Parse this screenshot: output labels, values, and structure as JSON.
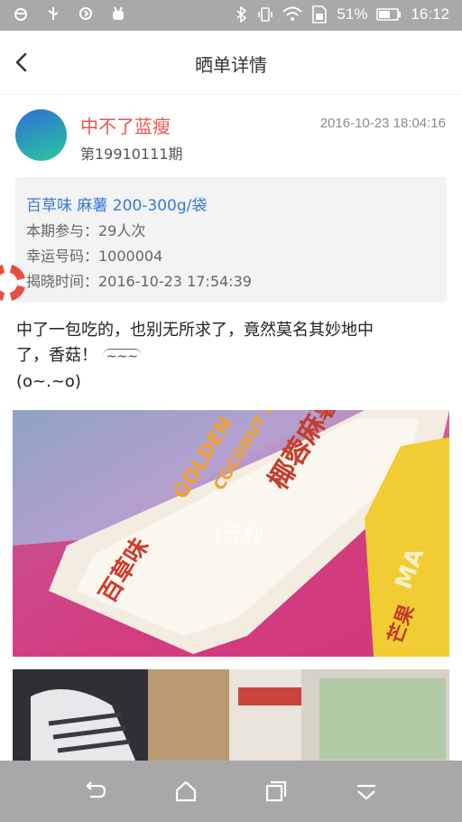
{
  "status_bar": {
    "battery_percent": "51%",
    "time": "16:12",
    "icons": [
      "bug-icon",
      "usb-icon",
      "sync-icon",
      "android-icon",
      "bluetooth-icon",
      "vibrate-icon",
      "wifi-icon",
      "sim-icon",
      "battery-icon"
    ]
  },
  "header": {
    "title": "晒单详情",
    "back_icon": "chevron-left-icon"
  },
  "post": {
    "user_name": "中不了蓝瘦",
    "period": "第19910111期",
    "timestamp": "2016-10-23 18:04:16"
  },
  "product": {
    "name": "百草味 麻薯 200-300g/袋",
    "participation": "本期参与：29人次",
    "lucky_number": "幸运号码：1000004",
    "reveal_time": "揭晓时间：2016-10-23 17:54:39"
  },
  "content": {
    "line1": "中了一包吃的，也别无所求了，竟然莫名其妙地中",
    "line2": "了，香菇！",
    "emoticon": "~~~",
    "line3": "(o~.~o)"
  },
  "photo1": {
    "watermark": "1元秒",
    "pack_texts": [
      "椰蓉麻薯",
      "COCONUT MOCHI",
      "GOLDEN",
      "百草味",
      "MA",
      "芒果"
    ]
  },
  "colors": {
    "accent_red": "#e8554e",
    "link_blue": "#3a78d8",
    "statusbar_gray": "#a9a9a9"
  },
  "nav_bar": {
    "buttons": [
      "back-icon",
      "home-icon",
      "recents-icon",
      "hide-icon"
    ]
  }
}
